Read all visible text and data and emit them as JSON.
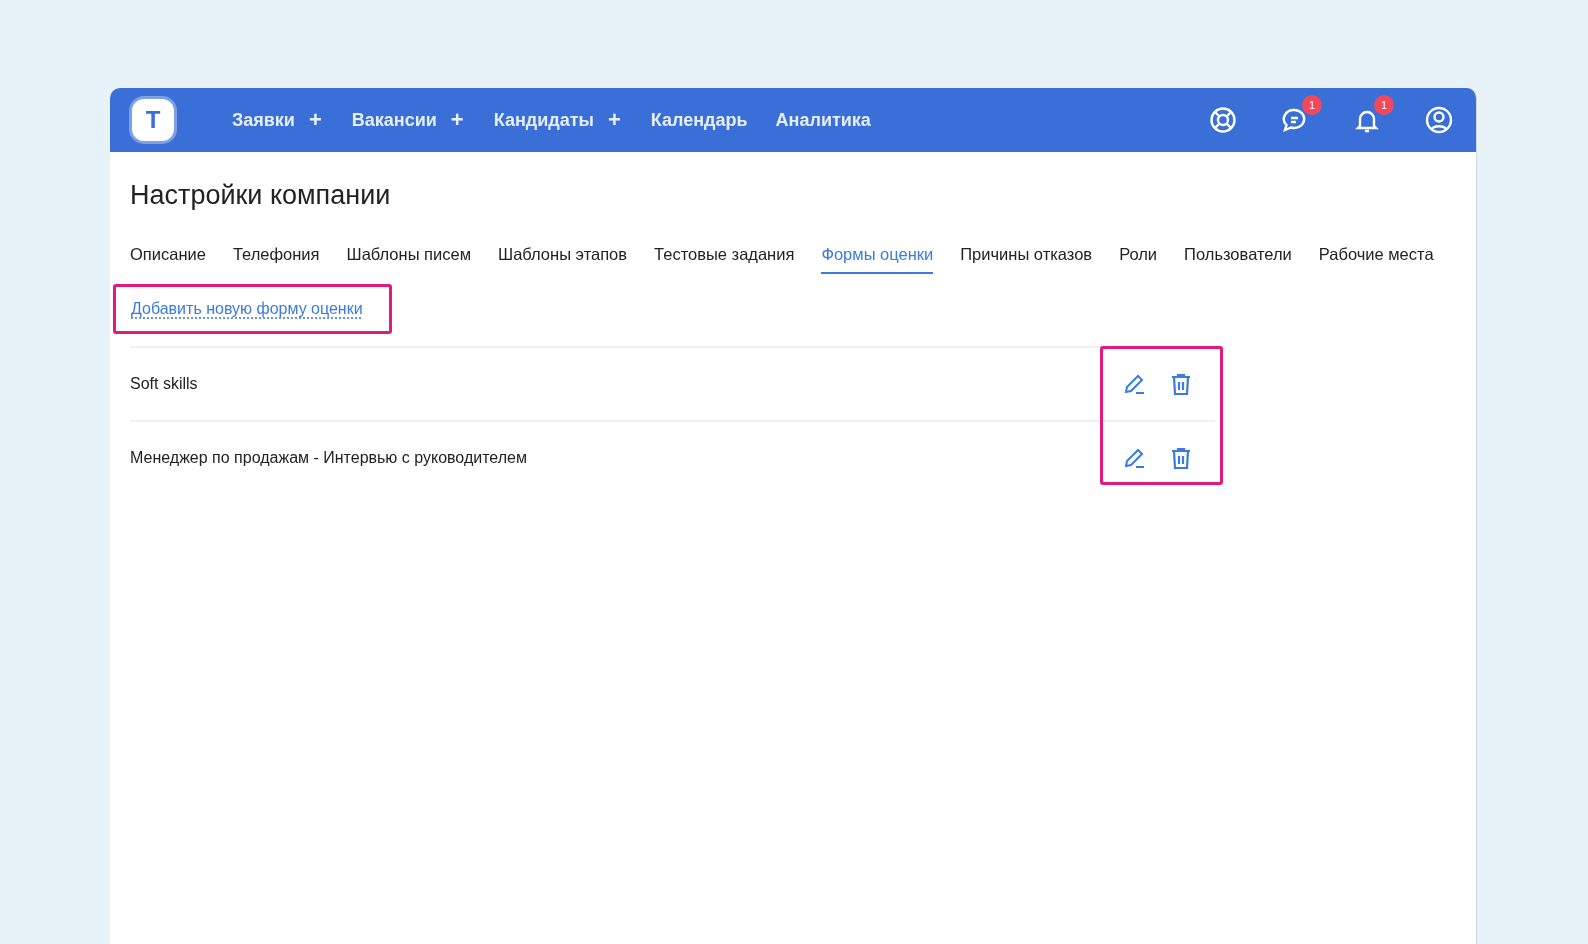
{
  "nav": {
    "logo": "T",
    "items": [
      {
        "label": "Заявки",
        "plus": "+"
      },
      {
        "label": "Вакансии",
        "plus": "+"
      },
      {
        "label": "Кандидаты",
        "plus": "+"
      },
      {
        "label": "Календарь"
      },
      {
        "label": "Аналитика"
      }
    ],
    "icons": [
      {
        "kind": "help"
      },
      {
        "kind": "chat",
        "badge": "1"
      },
      {
        "kind": "bell",
        "badge": "1"
      },
      {
        "kind": "user"
      }
    ]
  },
  "page": {
    "title": "Настройки компании",
    "tabs": [
      {
        "label": "Описание",
        "selected": false
      },
      {
        "label": "Телефония",
        "selected": false
      },
      {
        "label": "Шаблоны писем",
        "selected": false
      },
      {
        "label": "Шаблоны этапов",
        "selected": false
      },
      {
        "label": "Тестовые задания",
        "selected": false
      },
      {
        "label": "Формы оценки",
        "selected": true
      },
      {
        "label": "Причины отказов",
        "selected": false
      },
      {
        "label": "Роли",
        "selected": false
      },
      {
        "label": "Пользователи",
        "selected": false
      },
      {
        "label": "Рабочие места",
        "selected": false
      }
    ],
    "add_link": "Добавить новую форму оценки",
    "forms": [
      {
        "name": "Soft skills"
      },
      {
        "name": "Менеджер по продажам - Интервью с руководителем"
      }
    ]
  }
}
